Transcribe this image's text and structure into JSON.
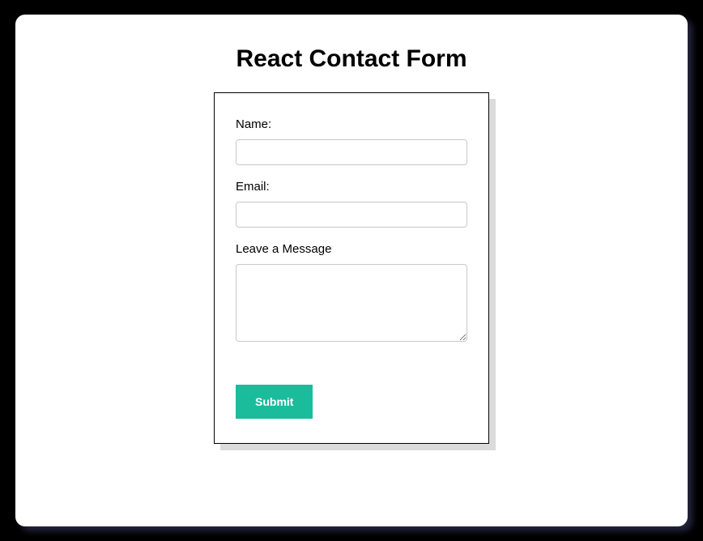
{
  "title": "React Contact Form",
  "form": {
    "name_label": "Name:",
    "name_value": "",
    "email_label": "Email:",
    "email_value": "",
    "message_label": "Leave a Message",
    "message_value": "",
    "submit_label": "Submit"
  },
  "colors": {
    "accent": "#1abc9c"
  }
}
